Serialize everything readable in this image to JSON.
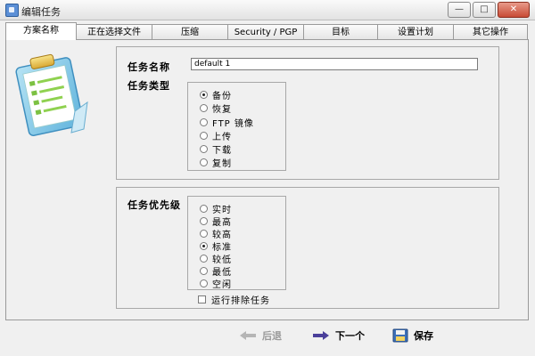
{
  "window": {
    "title": "编辑任务"
  },
  "tabs": [
    {
      "label": "方案名称",
      "active": true
    },
    {
      "label": "正在选择文件",
      "active": false
    },
    {
      "label": "压缩",
      "active": false
    },
    {
      "label": "Security / PGP",
      "active": false
    },
    {
      "label": "目标",
      "active": false
    },
    {
      "label": "设置计划",
      "active": false
    },
    {
      "label": "其它操作",
      "active": false
    }
  ],
  "task": {
    "name_label": "任务名称",
    "name_value": "default 1",
    "type_label": "任务类型",
    "types": [
      {
        "label": "备份",
        "selected": true
      },
      {
        "label": "恢复",
        "selected": false
      },
      {
        "label": "FTP 镜像",
        "selected": false
      },
      {
        "label": "上传",
        "selected": false
      },
      {
        "label": "下载",
        "selected": false
      },
      {
        "label": "复制",
        "selected": false
      }
    ]
  },
  "priority": {
    "label": "任务优先级",
    "options": [
      {
        "label": "实时",
        "selected": false
      },
      {
        "label": "最高",
        "selected": false
      },
      {
        "label": "较高",
        "selected": false
      },
      {
        "label": "标准",
        "selected": true
      },
      {
        "label": "较低",
        "selected": false
      },
      {
        "label": "最低",
        "selected": false
      },
      {
        "label": "空闲",
        "selected": false
      }
    ],
    "exclusive_label": "运行排除任务",
    "exclusive_checked": false
  },
  "buttons": {
    "back": "后退",
    "next": "下一个",
    "save": "保存"
  }
}
